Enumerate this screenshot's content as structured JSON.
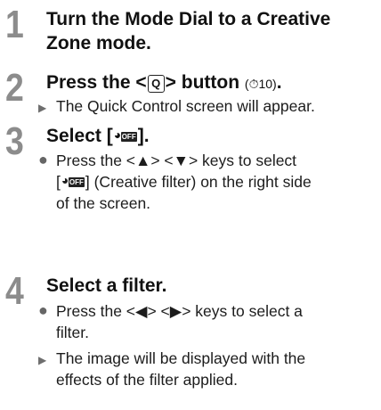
{
  "steps": [
    {
      "number": "1",
      "heading_lines": [
        "Turn the Mode Dial to a Creative",
        "Zone mode."
      ]
    },
    {
      "number": "2",
      "heading_pre": "Press the <",
      "key_label": "Q",
      "heading_post": "> button",
      "page_ref": "(⏱10)",
      "heading_end": ".",
      "bullets": [
        {
          "marker": "▶",
          "text": "The Quick Control screen will appear."
        }
      ]
    },
    {
      "number": "3",
      "heading_pre": "Select [",
      "icon_text": "OFF",
      "heading_post": "].",
      "bullets": [
        {
          "marker": "●",
          "line1": "Press the <▲> <▼> keys to select",
          "line2_pre": "[",
          "line2_icon": "OFF",
          "line2_post": "] (Creative filter) on the right side",
          "line3": "of the screen."
        }
      ]
    },
    {
      "number": "4",
      "heading": "Select a filter.",
      "bullets": [
        {
          "marker": "●",
          "lines": [
            "Press the <◀> <▶> keys to select a",
            "filter."
          ]
        },
        {
          "marker": "▶",
          "lines": [
            "The image will be displayed with the",
            "effects of the filter applied."
          ]
        }
      ]
    }
  ]
}
